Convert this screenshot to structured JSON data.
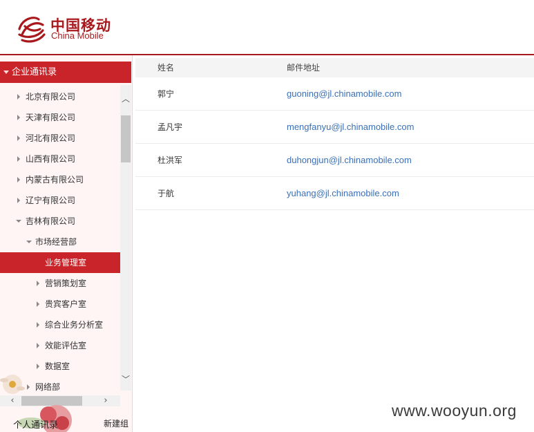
{
  "header": {
    "brand_cn": "中国移动",
    "brand_en": "China Mobile",
    "accent_color": "#a8191e"
  },
  "sidebar": {
    "title": "企业通讯录",
    "tree": [
      {
        "label": "北京有限公司",
        "expanded": false
      },
      {
        "label": "天津有限公司",
        "expanded": false
      },
      {
        "label": "河北有限公司",
        "expanded": false
      },
      {
        "label": "山西有限公司",
        "expanded": false
      },
      {
        "label": "内蒙古有限公司",
        "expanded": false
      },
      {
        "label": "辽宁有限公司",
        "expanded": false
      },
      {
        "label": "吉林有限公司",
        "expanded": true
      },
      {
        "label": "市场经营部",
        "expanded": true
      },
      {
        "label": "业务管理室",
        "selected": true
      },
      {
        "label": "营销策划室",
        "expanded": false
      },
      {
        "label": "贵宾客户室",
        "expanded": false
      },
      {
        "label": "综合业务分析室",
        "expanded": false
      },
      {
        "label": "效能评估室",
        "expanded": false
      },
      {
        "label": "数据室",
        "expanded": false
      },
      {
        "label": "网络部",
        "expanded": false
      }
    ],
    "personal_label": "个人通讯录",
    "new_group_label": "新建组"
  },
  "table": {
    "columns": [
      "姓名",
      "邮件地址"
    ],
    "rows": [
      {
        "name": "郭宁",
        "email": "guoning@jl.chinamobile.com"
      },
      {
        "name": "孟凡宇",
        "email": "mengfanyu@jl.chinamobile.com"
      },
      {
        "name": "杜洪军",
        "email": "duhongjun@jl.chinamobile.com"
      },
      {
        "name": "于航",
        "email": "yuhang@jl.chinamobile.com"
      }
    ]
  },
  "watermark": "www.wooyun.org",
  "colors": {
    "selected_bg": "#c9242a",
    "link": "#3a6fb7"
  }
}
